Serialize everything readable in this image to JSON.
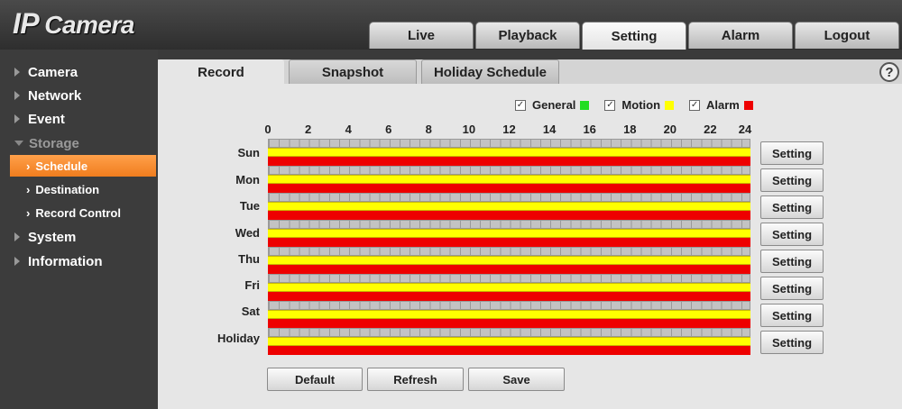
{
  "app": {
    "logo_ip": "IP",
    "logo_camera": "Camera"
  },
  "top_nav": [
    {
      "label": "Live",
      "active": false
    },
    {
      "label": "Playback",
      "active": false
    },
    {
      "label": "Setting",
      "active": true
    },
    {
      "label": "Alarm",
      "active": false
    },
    {
      "label": "Logout",
      "active": false
    }
  ],
  "sidebar": {
    "camera": "Camera",
    "network": "Network",
    "event": "Event",
    "storage": "Storage",
    "schedule": "Schedule",
    "destination": "Destination",
    "record_control": "Record Control",
    "system": "System",
    "information": "Information"
  },
  "panel_tabs": [
    {
      "label": "Record",
      "active": true
    },
    {
      "label": "Snapshot",
      "active": false
    },
    {
      "label": "Holiday Schedule",
      "active": false
    }
  ],
  "help_icon": "?",
  "legend": [
    {
      "label": "General",
      "checked": true,
      "color": "#22dd22"
    },
    {
      "label": "Motion",
      "checked": true,
      "color": "#ffff00"
    },
    {
      "label": "Alarm",
      "checked": true,
      "color": "#ee0000"
    }
  ],
  "hours": [
    "0",
    "2",
    "4",
    "6",
    "8",
    "10",
    "12",
    "14",
    "16",
    "18",
    "20",
    "22",
    "24"
  ],
  "days": [
    {
      "label": "Sun",
      "button": "Setting"
    },
    {
      "label": "Mon",
      "button": "Setting"
    },
    {
      "label": "Tue",
      "button": "Setting"
    },
    {
      "label": "Wed",
      "button": "Setting"
    },
    {
      "label": "Thu",
      "button": "Setting"
    },
    {
      "label": "Fri",
      "button": "Setting"
    },
    {
      "label": "Sat",
      "button": "Setting"
    },
    {
      "label": "Holiday",
      "button": "Setting"
    }
  ],
  "buttons": {
    "default": "Default",
    "refresh": "Refresh",
    "save": "Save"
  }
}
